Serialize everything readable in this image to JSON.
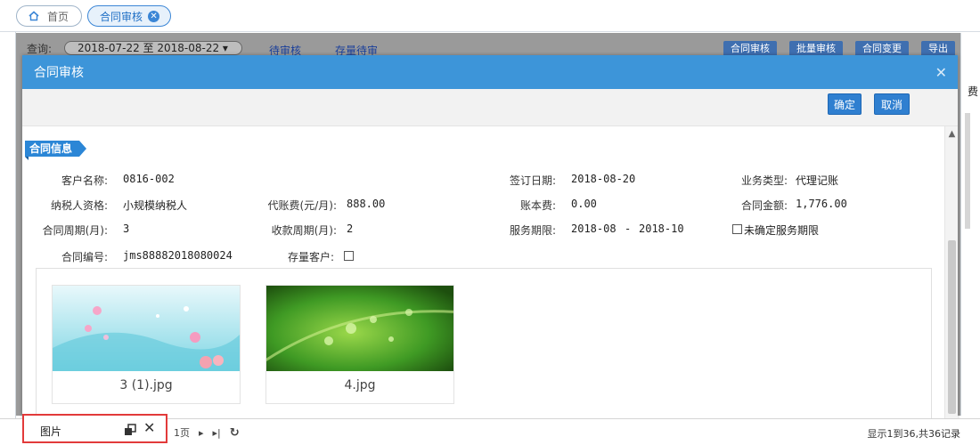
{
  "tabs": {
    "home_label": "首页",
    "active_label": "合同审核"
  },
  "background_page": {
    "query_label": "查询:",
    "date_range": "2018-07-22 至 2018-08-22 ▾",
    "link_pending": "待审核",
    "link_stock": "存量待审",
    "buttons": [
      "合同审核",
      "批量审核",
      "合同变更",
      "导出"
    ],
    "edge_text": "费"
  },
  "modal": {
    "title": "合同审核",
    "confirm_label": "确定",
    "cancel_label": "取消",
    "section_title": "合同信息",
    "fields": {
      "customer_name_label": "客户名称:",
      "customer_name": "0816-002",
      "sign_date_label": "签订日期:",
      "sign_date": "2018-08-20",
      "business_type_label": "业务类型:",
      "business_type": "代理记账",
      "taxpayer_label": "纳税人资格:",
      "taxpayer": "小规模纳税人",
      "agency_fee_label": "代账费(元/月):",
      "agency_fee": "888.00",
      "book_fee_label": "账本费:",
      "book_fee": "0.00",
      "contract_amount_label": "合同金额:",
      "contract_amount": "1,776.00",
      "contract_period_label": "合同周期(月):",
      "contract_period": "3",
      "payment_period_label": "收款周期(月):",
      "payment_period": "2",
      "service_term_label": "服务期限:",
      "service_term_start": "2018-08",
      "service_term_sep": "-",
      "service_term_end": "2018-10",
      "undetermined_label": "未确定服务期限",
      "contract_no_label": "合同编号:",
      "contract_no": "jms88882018080024",
      "stock_customer_label": "存量客户:"
    },
    "images": [
      {
        "caption": "3 (1).jpg"
      },
      {
        "caption": "4.jpg"
      }
    ]
  },
  "bottom": {
    "page_text": "1页",
    "record_info": "显示1到36,共36记录"
  },
  "minimized_window": {
    "title": "图片"
  },
  "colors": {
    "header_blue": "#3d95d9",
    "button_blue": "#2f7fd0",
    "highlight_red": "#e23a3a"
  }
}
